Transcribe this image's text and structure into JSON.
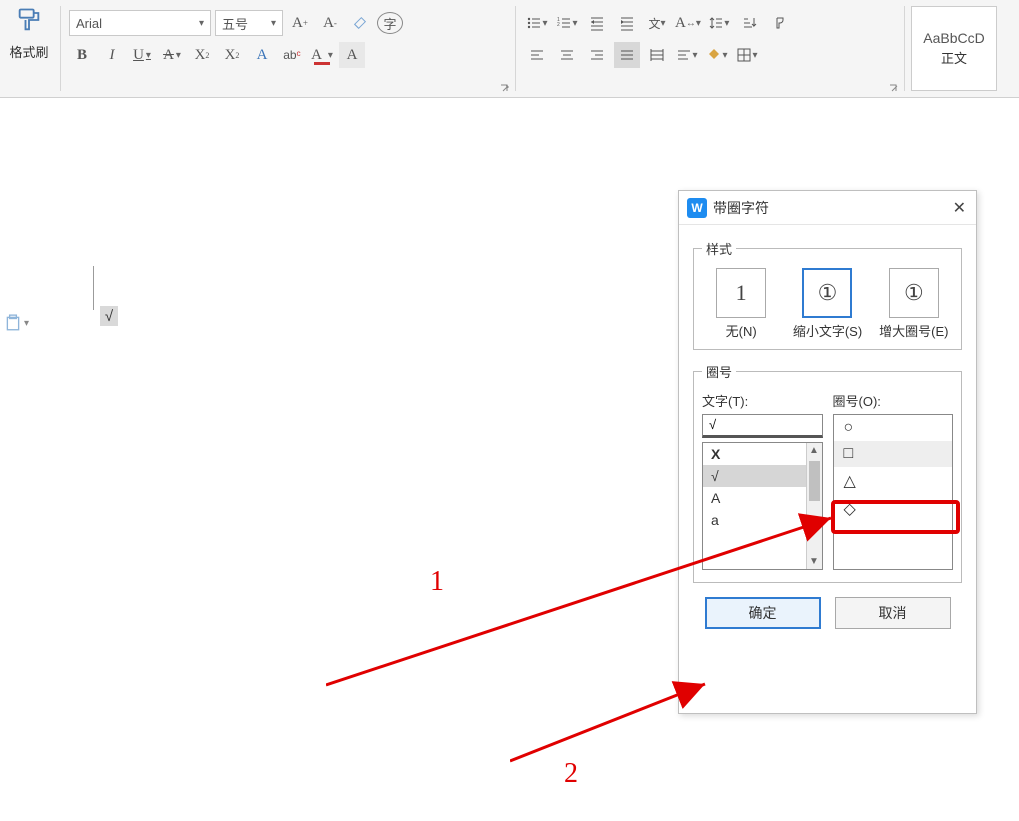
{
  "ribbon": {
    "format_painter": "格式刷",
    "font_name": "Arial",
    "font_size": "五号",
    "buttons": {
      "grow": "A⁺",
      "shrink": "A⁻",
      "clear": "◇",
      "enclose": "字",
      "bold": "B",
      "italic": "I",
      "underline": "U",
      "strike": "A",
      "sup": "X²",
      "sub": "X₂",
      "texteffect": "A",
      "phonetic": "ab",
      "fontcolor": "A",
      "highlight": "A"
    },
    "style": {
      "sample": "AaBbCcD",
      "label": "正文"
    }
  },
  "document": {
    "check": "√"
  },
  "dialog": {
    "title": "带圈字符",
    "style_group": "样式",
    "styles": {
      "none": {
        "glyph": "1",
        "label": "无(N)"
      },
      "shrink": {
        "glyph": "①",
        "label": "缩小文字(S)"
      },
      "enlarge": {
        "glyph": "①",
        "label": "增大圈号(E)"
      }
    },
    "enclose_group": "圈号",
    "text_label": "文字(T):",
    "text_value": "√",
    "text_options": [
      "X",
      "√",
      "A",
      "a"
    ],
    "shape_label": "圈号(O):",
    "shape_options": [
      "○",
      "□",
      "△",
      "◇"
    ],
    "ok": "确定",
    "cancel": "取消"
  },
  "annotations": {
    "one": "1",
    "two": "2"
  }
}
